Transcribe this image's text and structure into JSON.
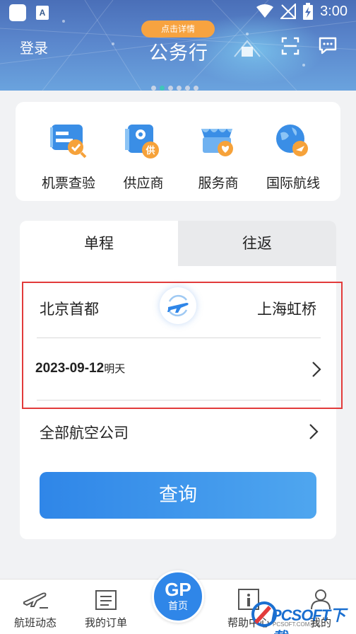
{
  "status_bar": {
    "time": "3:00",
    "app_badge": "A"
  },
  "header": {
    "login_label": "登录",
    "badge_label": "点击详情",
    "brand_title": "公务行"
  },
  "carousel": {
    "count": 6,
    "active_index": 1
  },
  "quick_links": [
    {
      "label": "机票查验",
      "icon": "ticket-check-icon"
    },
    {
      "label": "供应商",
      "icon": "supplier-icon"
    },
    {
      "label": "服务商",
      "icon": "service-provider-icon"
    },
    {
      "label": "国际航线",
      "icon": "international-route-icon"
    }
  ],
  "booking": {
    "tabs": [
      {
        "label": "单程",
        "active": true
      },
      {
        "label": "往返",
        "active": false
      }
    ],
    "from_city": "北京首都",
    "to_city": "上海虹桥",
    "date": "2023-09-12",
    "date_relative": "明天",
    "airline": "全部航空公司",
    "search_label": "查询"
  },
  "bottom_nav": {
    "items": [
      {
        "label": "航班动态",
        "icon": "flight-status-icon"
      },
      {
        "label": "我的订单",
        "icon": "orders-icon"
      },
      {
        "label": "首页",
        "icon": "home-gp-icon",
        "center_mark": "GP"
      },
      {
        "label": "帮助中心",
        "icon": "help-icon"
      },
      {
        "label": "我的",
        "icon": "profile-icon"
      }
    ]
  },
  "watermark": {
    "text": "PCSOFT下载",
    "sub": "PCSOFT.COM.CN"
  },
  "colors": {
    "accent": "#2f86e8",
    "badge": "#f7a340",
    "highlight_border": "#e23b3b",
    "icon_blue": "#3a8ee6",
    "icon_orange": "#f6a23a"
  }
}
